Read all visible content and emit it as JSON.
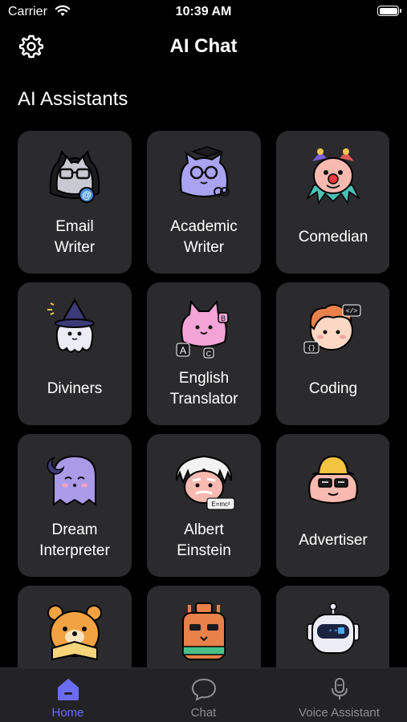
{
  "status_bar": {
    "carrier": "Carrier",
    "time": "10:39 AM"
  },
  "header": {
    "title": "AI Chat",
    "settings_icon": "gear-icon"
  },
  "section_title": "AI Assistants",
  "assistants": [
    {
      "label": "Email\nWriter",
      "icon": "email-writer-avatar-icon"
    },
    {
      "label": "Academic\nWriter",
      "icon": "academic-writer-avatar-icon"
    },
    {
      "label": "Comedian",
      "icon": "comedian-avatar-icon"
    },
    {
      "label": "Diviners",
      "icon": "diviners-avatar-icon"
    },
    {
      "label": "English\nTranslator",
      "icon": "english-translator-avatar-icon",
      "icon_texts": [
        "A",
        "B",
        "C"
      ]
    },
    {
      "label": "Coding",
      "icon": "coding-avatar-icon",
      "icon_texts": [
        "</>",
        "{}"
      ]
    },
    {
      "label": "Dream\nInterpreter",
      "icon": "dream-interpreter-avatar-icon"
    },
    {
      "label": "Albert\nEinstein",
      "icon": "albert-einstein-avatar-icon",
      "icon_texts": [
        "E=mc²"
      ]
    },
    {
      "label": "Advertiser",
      "icon": "advertiser-avatar-icon"
    },
    {
      "label": "",
      "icon": "bear-avatar-icon"
    },
    {
      "label": "",
      "icon": "robot-bottle-avatar-icon"
    },
    {
      "label": "",
      "icon": "robot-avatar-icon"
    }
  ],
  "tabs": [
    {
      "label": "Home",
      "icon": "home-icon",
      "active": true
    },
    {
      "label": "Chat",
      "icon": "chat-bubble-icon",
      "active": false
    },
    {
      "label": "Voice Assistant",
      "icon": "microphone-icon",
      "active": false
    }
  ],
  "colors": {
    "background": "#000000",
    "card": "#2b2b2d",
    "tab_bar": "#232326",
    "accent": "#6c6cf2",
    "inactive": "#8e8e93"
  }
}
